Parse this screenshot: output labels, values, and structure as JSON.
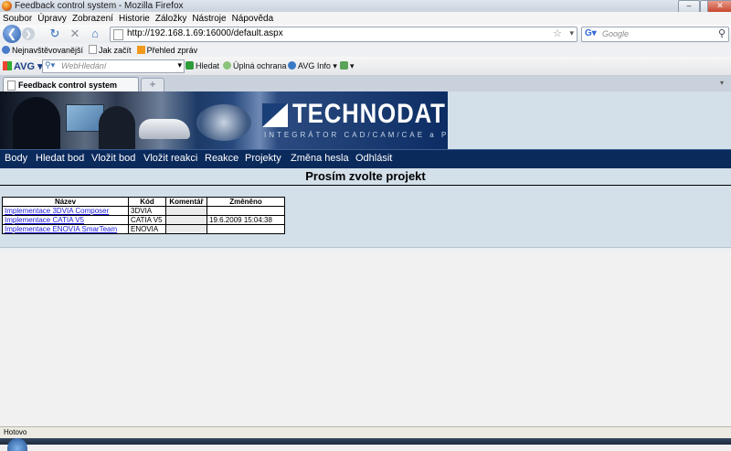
{
  "window": {
    "title": "Feedback control system - Mozilla Firefox",
    "buttons": [
      "–",
      "□",
      "✕"
    ]
  },
  "menubar": [
    "Soubor",
    "Úpravy",
    "Zobrazení",
    "Historie",
    "Záložky",
    "Nástroje",
    "Nápověda"
  ],
  "navbar": {
    "url": "http://192.168.1.69:16000/default.aspx",
    "search_placeholder": "Google"
  },
  "bookmarks": [
    "Nejnavštěvovanější",
    "Jak začít",
    "Přehled zpráv"
  ],
  "avg_toolbar": {
    "logo": "AVG",
    "search_placeholder": "WebHledání",
    "items": [
      "Hledat",
      "Úplná ochrana",
      "AVG Info"
    ]
  },
  "tab": {
    "title": "Feedback control system",
    "new_tab": "+"
  },
  "page": {
    "banner": {
      "brand": "TECHNODAT",
      "tagline": "INTEGRÁTOR CAD/CAM/CAE a PLM"
    },
    "nav": [
      "Body",
      "Hledat bod",
      "Vložit bod",
      "Vložit reakci",
      "Reakce",
      "Projekty",
      "Změna hesla",
      "Odhlásit"
    ],
    "heading": "Prosím zvolte projekt",
    "table": {
      "headers": [
        "Název",
        "Kód",
        "Komentář",
        "Změněno"
      ],
      "rows": [
        [
          "Implementace 3DVIA Composer",
          "3DVIA",
          "",
          ""
        ],
        [
          "Implementace CATIA V5",
          "CATIA V5",
          "",
          "19.6.2009 15:04:38"
        ],
        [
          "Implementace ENOVIA SmarTeam",
          "ENOVIA",
          "",
          ""
        ]
      ]
    }
  },
  "status": "Hotovo",
  "colors": {
    "nav_bg": "#0b2a5c",
    "page_bg": "#d3dfe9",
    "link": "#1b1bdc"
  }
}
